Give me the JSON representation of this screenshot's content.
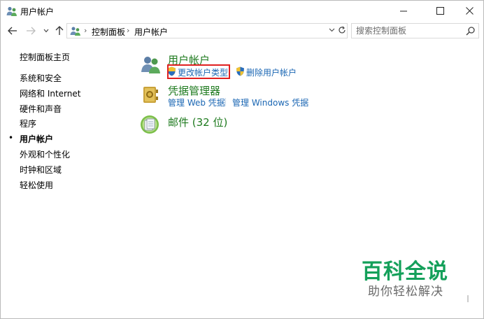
{
  "window": {
    "title": "用户帐户",
    "minimize_glyph": "—",
    "maximize_glyph": "☐",
    "close_glyph": "✕"
  },
  "nav": {
    "back_glyph": "←",
    "forward_glyph": "→",
    "recent_glyph": "⌄",
    "up_glyph": "↑"
  },
  "address": {
    "breadcrumbs": [
      "控制面板",
      "用户帐户"
    ],
    "separator": "›",
    "dropdown_glyph": "⌄",
    "refresh_glyph": "↻"
  },
  "search": {
    "placeholder": "搜索控制面板"
  },
  "sidebar": {
    "home": "控制面板主页",
    "bullet": "•",
    "items": [
      {
        "label": "系统和安全",
        "current": false
      },
      {
        "label": "网络和 Internet",
        "current": false
      },
      {
        "label": "硬件和声音",
        "current": false
      },
      {
        "label": "程序",
        "current": false
      },
      {
        "label": "用户帐户",
        "current": true
      },
      {
        "label": "外观和个性化",
        "current": false
      },
      {
        "label": "时钟和区域",
        "current": false
      },
      {
        "label": "轻松使用",
        "current": false
      }
    ]
  },
  "categories": [
    {
      "title": "用户帐户",
      "icon": "user-accounts-icon",
      "links": [
        {
          "label": "更改帐户类型",
          "icon": "uac-shield-icon"
        },
        {
          "label": "删除用户帐户",
          "icon": "uac-shield-icon"
        }
      ]
    },
    {
      "title": "凭据管理器",
      "icon": "credential-vault-icon",
      "links": [
        {
          "label": "管理 Web 凭据"
        },
        {
          "label": "管理 Windows 凭据"
        }
      ]
    },
    {
      "title": "邮件 (32 位)",
      "icon": "mail-icon",
      "links": []
    }
  ],
  "watermark": {
    "title": "百科全说",
    "subtitle": "助你轻松解决"
  },
  "colors": {
    "category_title": "#1e7a1e",
    "link": "#1a66b3",
    "highlight": "#e02020",
    "watermark": "#14a05a"
  }
}
